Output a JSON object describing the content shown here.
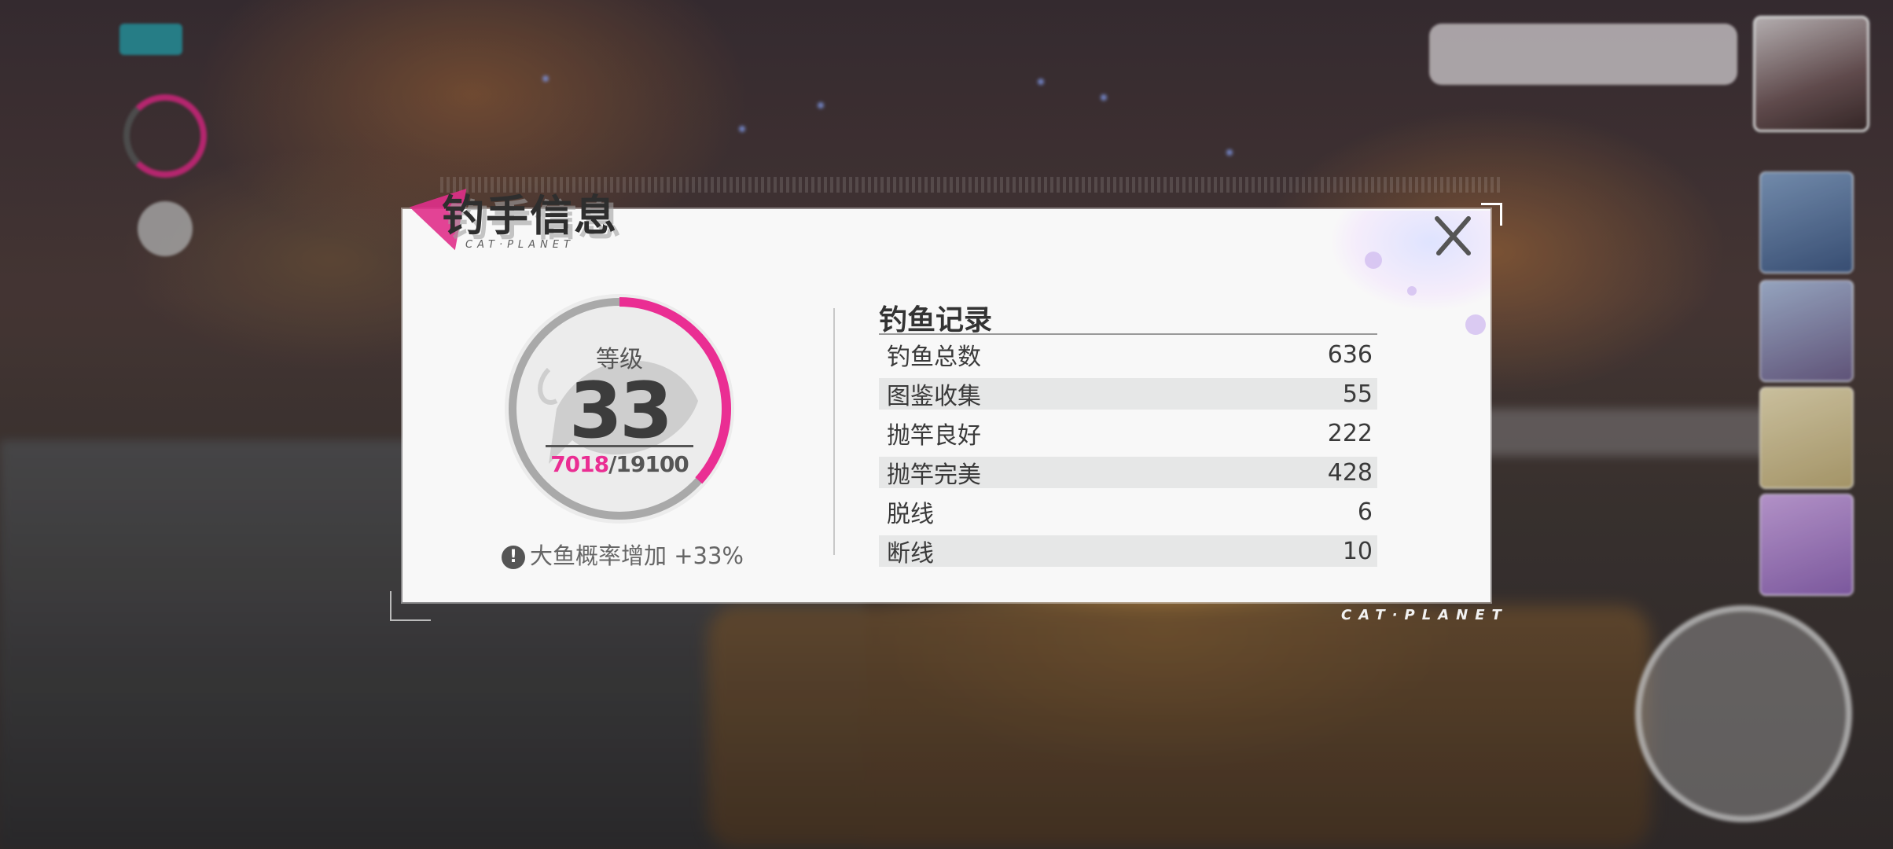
{
  "modal": {
    "title": "钓手信息",
    "subtitle": "CAT·PLANET",
    "brand": "CAT·PLANET",
    "close_icon": "close-x-icon"
  },
  "level": {
    "label": "等级",
    "value": "33",
    "exp_current": "7018",
    "exp_separator": "/",
    "exp_max": "19100",
    "progress": 0.367,
    "bonus_icon": "!",
    "bonus_text": "大鱼概率增加 +33%"
  },
  "records": {
    "title": "钓鱼记录",
    "items": [
      {
        "label": "钓鱼总数",
        "value": "636"
      },
      {
        "label": "图鉴收集",
        "value": "55"
      },
      {
        "label": "抛竿良好",
        "value": "222"
      },
      {
        "label": "抛竿完美",
        "value": "428"
      },
      {
        "label": "脱线",
        "value": "6"
      },
      {
        "label": "断线",
        "value": "10"
      }
    ]
  },
  "colors": {
    "accent": "#ea2e93",
    "text": "#3a3a3a",
    "panel": "#f8f8f8"
  }
}
